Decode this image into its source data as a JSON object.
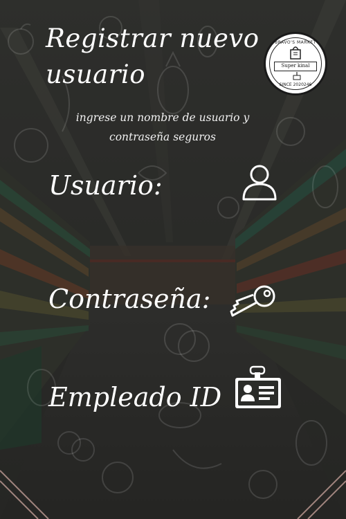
{
  "header": {
    "title": "Registrar nuevo usuario",
    "subtitle": "ingrese un nombre de usuario y contraseña seguros"
  },
  "logo": {
    "top_text": "BRAVO'S MARKET",
    "badge_text": "Super kinal",
    "bottom_text": "SINCE 2020246"
  },
  "form": {
    "username_label": "Usuario:",
    "password_label": "Contraseña:",
    "employee_id_label": "Empleado ID"
  },
  "icons": {
    "user": "user-icon",
    "key": "key-icon",
    "id_card": "id-card-icon"
  },
  "colors": {
    "text": "#ffffff",
    "overlay": "#2f302d"
  }
}
